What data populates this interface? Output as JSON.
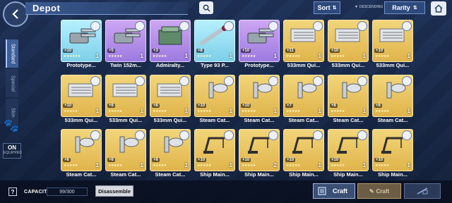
{
  "header": {
    "title": "Depot",
    "sort_label": "Sort",
    "descending_label": "DESCENDING",
    "rarity_label": "Rarity"
  },
  "tabs": [
    {
      "label": "Standard",
      "active": true
    },
    {
      "label": "Special",
      "active": false
    },
    {
      "label": "Skin",
      "active": false
    }
  ],
  "equip_toggle": {
    "state": "ON",
    "label": "EQUIPPED"
  },
  "items": [
    {
      "name": "Prototype...",
      "level": "+10",
      "count": "1",
      "rarity": "cyan",
      "icon": "turret-icon",
      "stars": "★★★★★★"
    },
    {
      "name": "Twin 152m...",
      "level": "+5",
      "count": "1",
      "rarity": "purple",
      "icon": "turret-icon",
      "stars": "★★★★★"
    },
    {
      "name": "Admiralty...",
      "level": "+3",
      "count": "1",
      "rarity": "purple",
      "icon": "radar-icon",
      "stars": "★★★★★"
    },
    {
      "name": "Type 93 P...",
      "level": "+8",
      "count": "1",
      "rarity": "cyan",
      "icon": "torpedo-icon",
      "stars": "★★★★★"
    },
    {
      "name": "Prototype...",
      "level": "+10",
      "count": "1",
      "rarity": "purple",
      "icon": "turret-icon",
      "stars": "★★★★★"
    },
    {
      "name": "533mm Qui...",
      "level": "+11",
      "count": "1",
      "rarity": "gold",
      "icon": "torpedo-tube-icon",
      "stars": "★★★★★"
    },
    {
      "name": "533mm Qui...",
      "level": "+10",
      "count": "1",
      "rarity": "gold",
      "icon": "torpedo-tube-icon",
      "stars": "★★★★★"
    },
    {
      "name": "533mm Qui...",
      "level": "+10",
      "count": "1",
      "rarity": "gold",
      "icon": "torpedo-tube-icon",
      "stars": "★★★★★"
    },
    {
      "name": "533mm Qui...",
      "level": "+10",
      "count": "1",
      "rarity": "gold",
      "icon": "torpedo-tube-icon",
      "stars": "★★★★★"
    },
    {
      "name": "533mm Qui...",
      "level": "+6",
      "count": "1",
      "rarity": "gold",
      "icon": "torpedo-tube-icon",
      "stars": "★★★★★"
    },
    {
      "name": "533mm Qui...",
      "level": "+6",
      "count": "1",
      "rarity": "gold",
      "icon": "torpedo-tube-icon",
      "stars": "★★★★★"
    },
    {
      "name": "Steam Cat...",
      "level": "+10",
      "count": "1",
      "rarity": "gold",
      "icon": "catapult-icon",
      "stars": "★★★★★"
    },
    {
      "name": "Steam Cat...",
      "level": "+10",
      "count": "1",
      "rarity": "gold",
      "icon": "catapult-icon",
      "stars": "★★★★★"
    },
    {
      "name": "Steam Cat...",
      "level": "+7",
      "count": "1",
      "rarity": "gold",
      "icon": "catapult-icon",
      "stars": "★★★★★"
    },
    {
      "name": "Steam Cat...",
      "level": "+6",
      "count": "1",
      "rarity": "gold",
      "icon": "catapult-icon",
      "stars": "★★★★★"
    },
    {
      "name": "Steam Cat...",
      "level": "+6",
      "count": "1",
      "rarity": "gold",
      "icon": "catapult-icon",
      "stars": "★★★★★"
    },
    {
      "name": "Steam Cat...",
      "level": "+6",
      "count": "1",
      "rarity": "gold",
      "icon": "catapult-icon",
      "stars": "★★★★★"
    },
    {
      "name": "Steam Cat...",
      "level": "+6",
      "count": "1",
      "rarity": "gold",
      "icon": "catapult-icon",
      "stars": "★★★★★"
    },
    {
      "name": "Steam Cat...",
      "level": "+6",
      "count": "1",
      "rarity": "gold",
      "icon": "catapult-icon",
      "stars": "★★★★★"
    },
    {
      "name": "Ship Main...",
      "level": "+10",
      "count": "1",
      "rarity": "gold",
      "icon": "crane-icon",
      "stars": "★★★★★"
    },
    {
      "name": "Ship Main...",
      "level": "+10",
      "count": "2",
      "rarity": "gold",
      "icon": "crane-icon",
      "stars": "★★★★★"
    },
    {
      "name": "Ship Main...",
      "level": "+10",
      "count": "1",
      "rarity": "gold",
      "icon": "crane-icon",
      "stars": "★★★★★"
    },
    {
      "name": "Ship Main...",
      "level": "+10",
      "count": "1",
      "rarity": "gold",
      "icon": "crane-icon",
      "stars": "★★★★★"
    },
    {
      "name": "Ship Main...",
      "level": "+10",
      "count": "1",
      "rarity": "gold",
      "icon": "crane-icon",
      "stars": "★★★★★"
    }
  ],
  "footer": {
    "capacity_label": "CAPACITY",
    "capacity_value": "99/300",
    "disassemble_label": "Disassemble",
    "craft_label": "Craft",
    "grind_label": "Craft"
  }
}
